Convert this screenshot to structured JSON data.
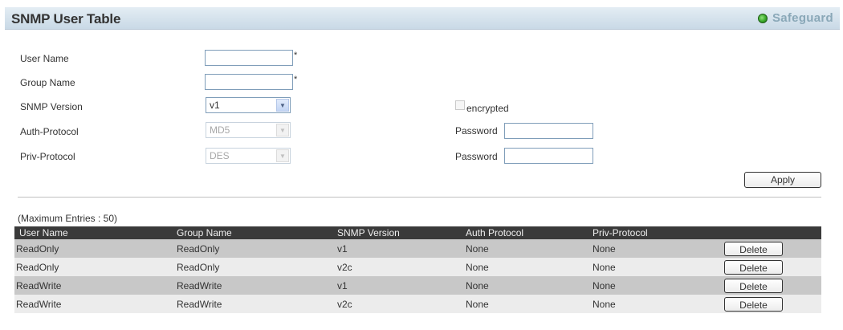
{
  "header": {
    "title": "SNMP User Table",
    "safeguard_label": "Safeguard"
  },
  "form": {
    "user_name": {
      "label": "User Name",
      "value": "",
      "required_mark": "*"
    },
    "group_name": {
      "label": "Group Name",
      "value": "",
      "required_mark": "*"
    },
    "snmp_version": {
      "label": "SNMP Version",
      "selected": "v1"
    },
    "auth_protocol": {
      "label": "Auth-Protocol",
      "selected": "MD5",
      "disabled": true
    },
    "priv_protocol": {
      "label": "Priv-Protocol",
      "selected": "DES",
      "disabled": true
    },
    "encrypted": {
      "label": "encrypted",
      "checked": false
    },
    "auth_password": {
      "label": "Password",
      "value": ""
    },
    "priv_password": {
      "label": "Password",
      "value": ""
    },
    "apply_label": "Apply"
  },
  "table": {
    "max_entries": "(Maximum Entries : 50)",
    "columns": [
      "User Name",
      "Group Name",
      "SNMP Version",
      "Auth Protocol",
      "Priv-Protocol"
    ],
    "rows": [
      {
        "user": "ReadOnly",
        "group": "ReadOnly",
        "version": "v1",
        "auth": "None",
        "priv": "None",
        "action": "Delete"
      },
      {
        "user": "ReadOnly",
        "group": "ReadOnly",
        "version": "v2c",
        "auth": "None",
        "priv": "None",
        "action": "Delete"
      },
      {
        "user": "ReadWrite",
        "group": "ReadWrite",
        "version": "v1",
        "auth": "None",
        "priv": "None",
        "action": "Delete"
      },
      {
        "user": "ReadWrite",
        "group": "ReadWrite",
        "version": "v2c",
        "auth": "None",
        "priv": "None",
        "action": "Delete"
      }
    ]
  },
  "colors": {
    "header_bg": "#d5e2ec",
    "table_header_bg": "#3a3a3a",
    "row_dark": "#c8c8c8",
    "row_light": "#ececec",
    "safeguard_led": "#3aa82a"
  }
}
